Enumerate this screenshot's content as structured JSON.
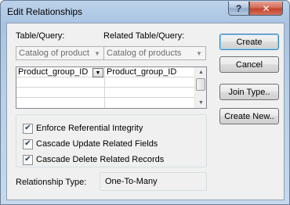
{
  "window": {
    "title": "Edit Relationships",
    "help_glyph": "?",
    "close_glyph": "✕"
  },
  "table_query": {
    "label": "Table/Query:",
    "value": "Catalog of product"
  },
  "related_table_query": {
    "label": "Related Table/Query:",
    "value": "Catalog of products"
  },
  "fields_grid": {
    "rows": [
      {
        "left": "Product_group_ID",
        "right": "Product_group_ID"
      },
      {
        "left": "",
        "right": ""
      },
      {
        "left": "",
        "right": ""
      },
      {
        "left": "",
        "right": ""
      }
    ]
  },
  "options": {
    "enforce_ri": {
      "label": "Enforce Referential Integrity",
      "checked": true
    },
    "cascade_update": {
      "label": "Cascade Update Related Fields",
      "checked": true
    },
    "cascade_delete": {
      "label": "Cascade Delete Related Records",
      "checked": true
    }
  },
  "relationship_type": {
    "label": "Relationship Type:",
    "value": "One-To-Many"
  },
  "buttons": {
    "create": "Create",
    "cancel": "Cancel",
    "join_type": "Join Type..",
    "create_new": "Create New.."
  },
  "colors": {
    "title_gradient_top": "#bcd3ea",
    "close_red": "#c2432a",
    "default_button_border": "#3c7fb1"
  }
}
